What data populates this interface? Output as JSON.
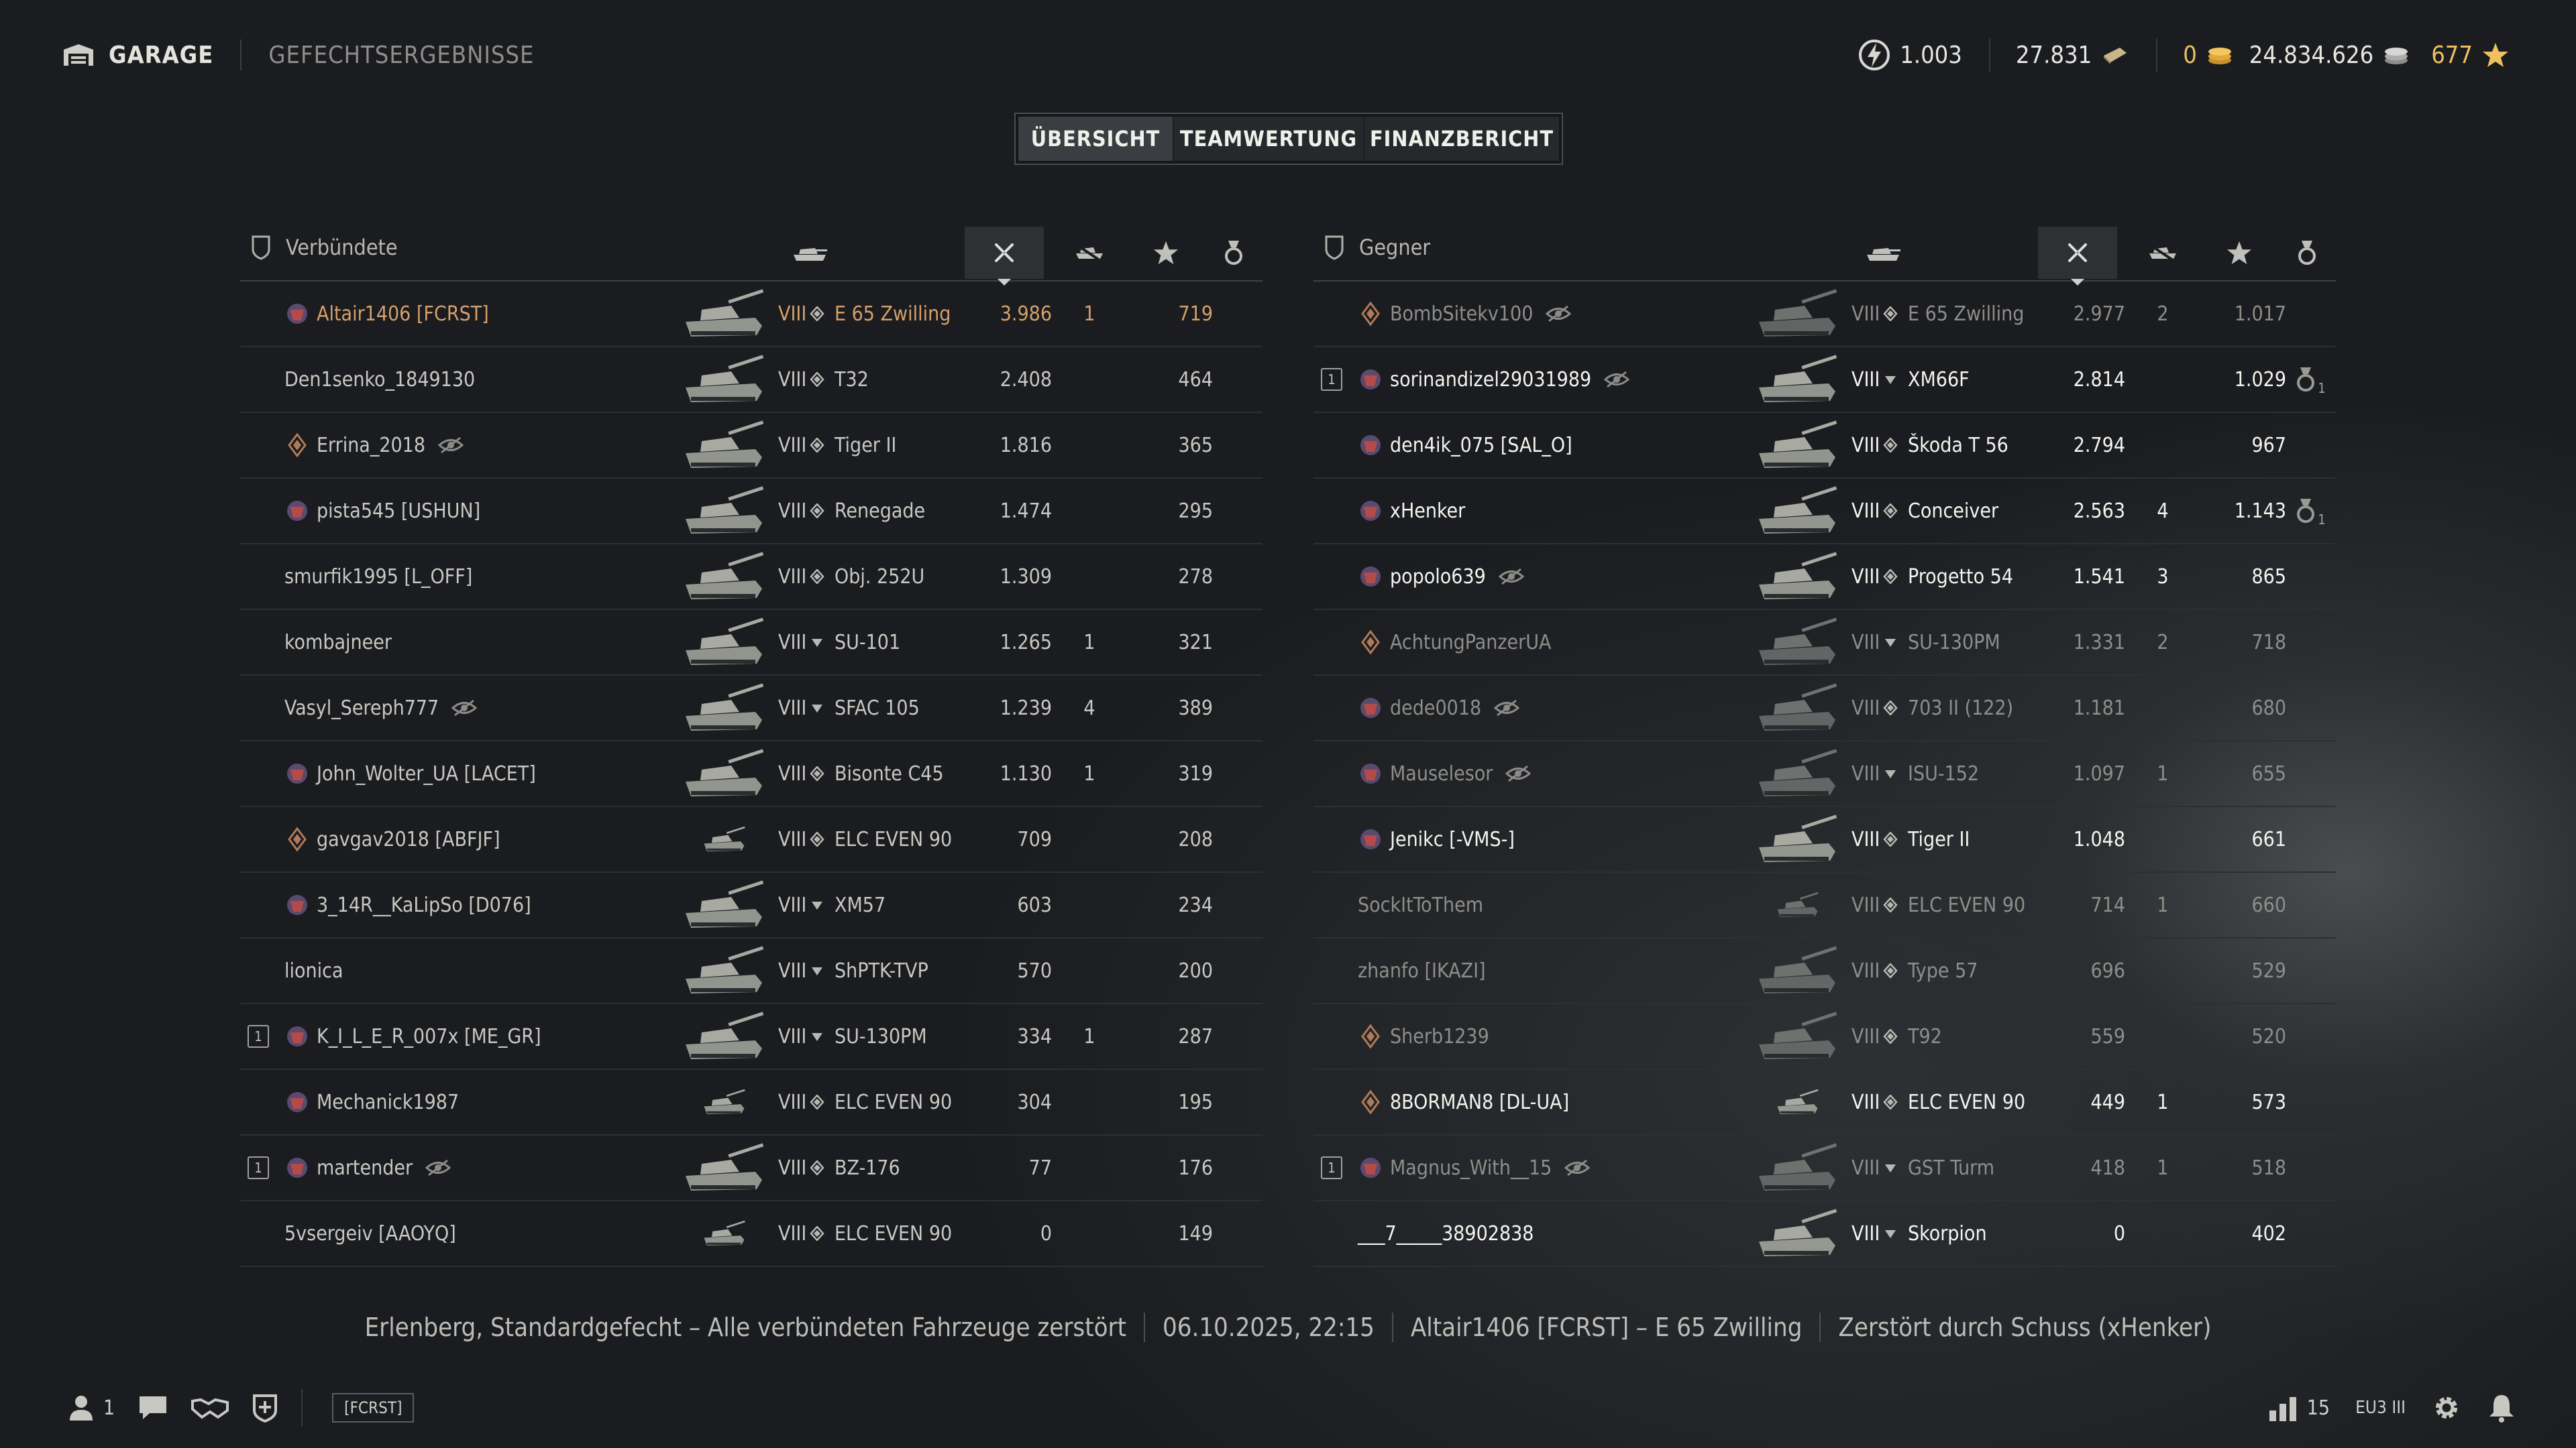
{
  "nav": {
    "garage": "GARAGE",
    "results": "GEFECHTSERGEBNISSE"
  },
  "currency": {
    "free_xp": "1.003",
    "bonds": "27.831",
    "gold": "0",
    "credits": "24.834.626",
    "stars": "677"
  },
  "tabs": [
    {
      "label": "ÜBERSICHT",
      "active": true
    },
    {
      "label": "TEAMWERTUNG",
      "active": false
    },
    {
      "label": "FINANZBERICHT",
      "active": false
    }
  ],
  "allies": {
    "title": "Verbündete",
    "rows": [
      {
        "name": "Altair1406 [FCRST]",
        "tier": "VIII",
        "vehicle": "E 65 Zwilling",
        "damage": "3.986",
        "kills": "1",
        "xp": "719",
        "player": true,
        "emblem": "clan"
      },
      {
        "name": "Den1senko_1849130",
        "tier": "VIII",
        "vehicle": "T32",
        "damage": "2.408",
        "kills": "",
        "xp": "464"
      },
      {
        "name": "Errina_2018",
        "tier": "VIII",
        "vehicle": "Tiger II",
        "damage": "1.816",
        "kills": "",
        "xp": "365",
        "hidden": true,
        "emblem": "chevron"
      },
      {
        "name": "pista545 [USHUN]",
        "tier": "VIII",
        "vehicle": "Renegade",
        "damage": "1.474",
        "kills": "",
        "xp": "295",
        "emblem": "clan"
      },
      {
        "name": "smurfik1995 [L_OFF]",
        "tier": "VIII",
        "vehicle": "Obj. 252U",
        "damage": "1.309",
        "kills": "",
        "xp": "278"
      },
      {
        "name": "kombajneer",
        "tier": "VIII",
        "vehicle": "SU-101",
        "damage": "1.265",
        "kills": "1",
        "xp": "321",
        "td": true
      },
      {
        "name": "Vasyl_Sereph777",
        "tier": "VIII",
        "vehicle": "SFAC 105",
        "damage": "1.239",
        "kills": "4",
        "xp": "389",
        "hidden": true,
        "td": true
      },
      {
        "name": "John_Wolter_UA [LACET]",
        "tier": "VIII",
        "vehicle": "Bisonte C45",
        "damage": "1.130",
        "kills": "1",
        "xp": "319",
        "emblem": "clan"
      },
      {
        "name": "gavgav2018 [ABFJF]",
        "tier": "VIII",
        "vehicle": "ELC EVEN 90",
        "damage": "709",
        "kills": "",
        "xp": "208",
        "emblem": "chevron",
        "light": true
      },
      {
        "name": "3_14R__KaLipSo [D076]",
        "tier": "VIII",
        "vehicle": "XM57",
        "damage": "603",
        "kills": "",
        "xp": "234",
        "emblem": "clan",
        "td": true
      },
      {
        "name": "lionica",
        "tier": "VIII",
        "vehicle": "ShPTK-TVP",
        "damage": "570",
        "kills": "",
        "xp": "200",
        "td": true
      },
      {
        "name": "K_I_L_E_R_007x [ME_GR]",
        "tier": "VIII",
        "vehicle": "SU-130PM",
        "damage": "334",
        "kills": "1",
        "xp": "287",
        "platoon": "1",
        "emblem": "clan",
        "td": true
      },
      {
        "name": "Mechanick1987",
        "tier": "VIII",
        "vehicle": "ELC EVEN 90",
        "damage": "304",
        "kills": "",
        "xp": "195",
        "emblem": "clan",
        "light": true
      },
      {
        "name": "martender",
        "tier": "VIII",
        "vehicle": "BZ-176",
        "damage": "77",
        "kills": "",
        "xp": "176",
        "platoon": "1",
        "hidden": true,
        "emblem": "clan"
      },
      {
        "name": "5vsergeiv [AAOYQ]",
        "tier": "VIII",
        "vehicle": "ELC EVEN 90",
        "damage": "0",
        "kills": "",
        "xp": "149",
        "light": true
      }
    ]
  },
  "enemies": {
    "title": "Gegner",
    "rows": [
      {
        "name": "BombSitekv100",
        "tier": "VIII",
        "vehicle": "E 65 Zwilling",
        "damage": "2.977",
        "kills": "2",
        "xp": "1.017",
        "hidden": true,
        "emblem": "chevron",
        "style": "dim"
      },
      {
        "name": "sorinandizel29031989",
        "tier": "VIII",
        "vehicle": "XM66F",
        "damage": "2.814",
        "kills": "",
        "xp": "1.029",
        "hidden": true,
        "platoon": "1",
        "emblem": "clan",
        "medal": "1",
        "style": "hl",
        "td": true
      },
      {
        "name": "den4ik_075 [SAL_O]",
        "tier": "VIII",
        "vehicle": "Škoda T 56",
        "damage": "2.794",
        "kills": "",
        "xp": "967",
        "emblem": "clan",
        "style": "hl"
      },
      {
        "name": "xHenker",
        "tier": "VIII",
        "vehicle": "Conceiver",
        "damage": "2.563",
        "kills": "4",
        "xp": "1.143",
        "emblem": "clan",
        "medal": "1",
        "style": "hl"
      },
      {
        "name": "popolo639",
        "tier": "VIII",
        "vehicle": "Progetto 54",
        "damage": "1.541",
        "kills": "3",
        "xp": "865",
        "hidden": true,
        "emblem": "clan",
        "style": "hl"
      },
      {
        "name": "AchtungPanzerUA",
        "tier": "VIII",
        "vehicle": "SU-130PM",
        "damage": "1.331",
        "kills": "2",
        "xp": "718",
        "emblem": "chevron",
        "style": "dim",
        "td": true
      },
      {
        "name": "dede0018",
        "tier": "VIII",
        "vehicle": "703 II (122)",
        "damage": "1.181",
        "kills": "",
        "xp": "680",
        "hidden": true,
        "emblem": "clan",
        "style": "dim"
      },
      {
        "name": "Mauselesor",
        "tier": "VIII",
        "vehicle": "ISU-152",
        "damage": "1.097",
        "kills": "1",
        "xp": "655",
        "hidden": true,
        "emblem": "clan",
        "style": "dim",
        "td": true
      },
      {
        "name": "Jenikc [-VMS-]",
        "tier": "VIII",
        "vehicle": "Tiger II",
        "damage": "1.048",
        "kills": "",
        "xp": "661",
        "emblem": "clan",
        "style": "hl"
      },
      {
        "name": "SockItToThem",
        "tier": "VIII",
        "vehicle": "ELC EVEN 90",
        "damage": "714",
        "kills": "1",
        "xp": "660",
        "style": "dim",
        "light": true
      },
      {
        "name": "zhanfo [IKAZI]",
        "tier": "VIII",
        "vehicle": "Type 57",
        "damage": "696",
        "kills": "",
        "xp": "529",
        "style": "dim"
      },
      {
        "name": "Sherb1239",
        "tier": "VIII",
        "vehicle": "T92",
        "damage": "559",
        "kills": "",
        "xp": "520",
        "emblem": "chevron",
        "style": "dim"
      },
      {
        "name": "8BORMAN8 [DL-UA]",
        "tier": "VIII",
        "vehicle": "ELC EVEN 90",
        "damage": "449",
        "kills": "1",
        "xp": "573",
        "emblem": "chevron",
        "style": "hl",
        "light": true
      },
      {
        "name": "Magnus_With__15",
        "tier": "VIII",
        "vehicle": "GST Turm",
        "damage": "418",
        "kills": "1",
        "xp": "518",
        "hidden": true,
        "platoon": "1",
        "emblem": "clan",
        "style": "dim",
        "td": true
      },
      {
        "name": "___7_____38902838",
        "tier": "VIII",
        "vehicle": "Skorpion",
        "damage": "0",
        "kills": "",
        "xp": "402",
        "style": "hl",
        "td": true
      }
    ]
  },
  "summary": {
    "map": "Erlenberg, Standardgefecht – Alle verbündeten Fahrzeuge zerstört",
    "datetime": "06.10.2025, 22:15",
    "vehicle": "Altair1406 [FCRST] – E 65 Zwilling",
    "fate": "Zerstört durch Schuss (xHenker)"
  },
  "bottom": {
    "friends_count": "1",
    "clan_tag": "[FCRST]",
    "ping": "15",
    "server": "EU3 III"
  },
  "colors": {
    "background": "#1a1c1f",
    "player_highlight": "#d5a06a",
    "gold": "#f0c060"
  }
}
